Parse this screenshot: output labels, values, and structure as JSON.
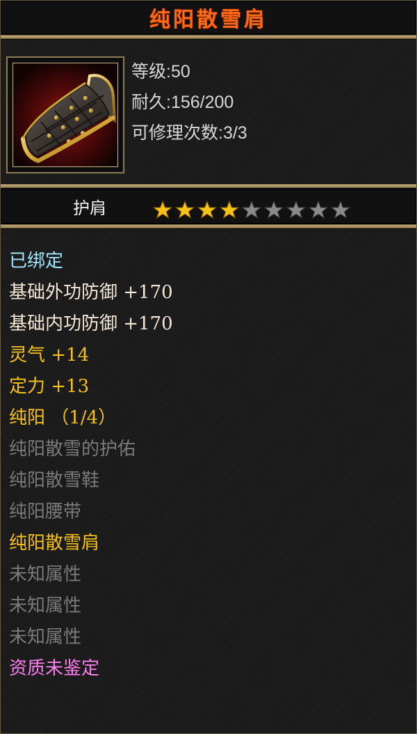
{
  "item": {
    "name": "纯阳散雪肩",
    "icon": "shoulder-armor-icon",
    "level_line": "等级:50",
    "durability_line": "耐久:156/200",
    "repair_line": "可修理次数:3/3",
    "type": "护肩",
    "stars_filled": 4,
    "stars_total": 9,
    "star_colors": {
      "filled": "#f6c21a",
      "empty": "#8a8a8a"
    }
  },
  "attributes": [
    {
      "text": "已绑定",
      "style": "bind"
    },
    {
      "text": "基础外功防御 +170",
      "style": "white"
    },
    {
      "text": "基础内功防御 +170",
      "style": "white"
    },
    {
      "text": "灵气 +14",
      "style": "gold"
    },
    {
      "text": "定力 +13",
      "style": "gold"
    },
    {
      "text": "纯阳 （1/4）",
      "style": "gold"
    },
    {
      "text": "纯阳散雪的护佑",
      "style": "grey"
    },
    {
      "text": "纯阳散雪鞋",
      "style": "grey"
    },
    {
      "text": "纯阳腰带",
      "style": "grey"
    },
    {
      "text": "纯阳散雪肩",
      "style": "gold"
    },
    {
      "text": "未知属性",
      "style": "grey"
    },
    {
      "text": "未知属性",
      "style": "grey"
    },
    {
      "text": "未知属性",
      "style": "grey"
    },
    {
      "text": "资质未鉴定",
      "style": "pink"
    }
  ],
  "colors": {
    "title": "#ff6a1a",
    "bind": "#9fe8ff",
    "white": "#f5e8d6",
    "gold": "#f6c21a",
    "grey": "#7a7a7a",
    "pink": "#ff7ef0"
  }
}
